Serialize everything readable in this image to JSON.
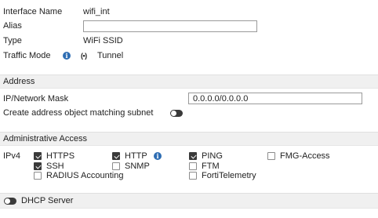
{
  "interface": {
    "name_label": "Interface Name",
    "name_value": "wifi_int",
    "alias_label": "Alias",
    "alias_value": "",
    "type_label": "Type",
    "type_value": "WiFi SSID",
    "traffic_label": "Traffic Mode",
    "traffic_value": "Tunnel",
    "info_glyph": "i",
    "tunnel_glyph": "(•)"
  },
  "address": {
    "section_title": "Address",
    "ip_label": "IP/Network Mask",
    "ip_value": "0.0.0.0/0.0.0.0",
    "create_label": "Create address object matching subnet",
    "create_enabled": false
  },
  "admin": {
    "section_title": "Administrative Access",
    "ipv4_label": "IPv4",
    "options": {
      "https": {
        "label": "HTTPS",
        "checked": true
      },
      "http": {
        "label": "HTTP",
        "checked": true
      },
      "ping": {
        "label": "PING",
        "checked": true
      },
      "fmg": {
        "label": "FMG-Access",
        "checked": false
      },
      "ssh": {
        "label": "SSH",
        "checked": true
      },
      "snmp": {
        "label": "SNMP",
        "checked": false
      },
      "ftm": {
        "label": "FTM",
        "checked": false
      },
      "radius": {
        "label": "RADIUS Accounting",
        "checked": false
      },
      "fortitelemetry": {
        "label": "FortiTelemetry",
        "checked": false
      }
    }
  },
  "dhcp": {
    "label": "DHCP Server",
    "enabled": false
  }
}
